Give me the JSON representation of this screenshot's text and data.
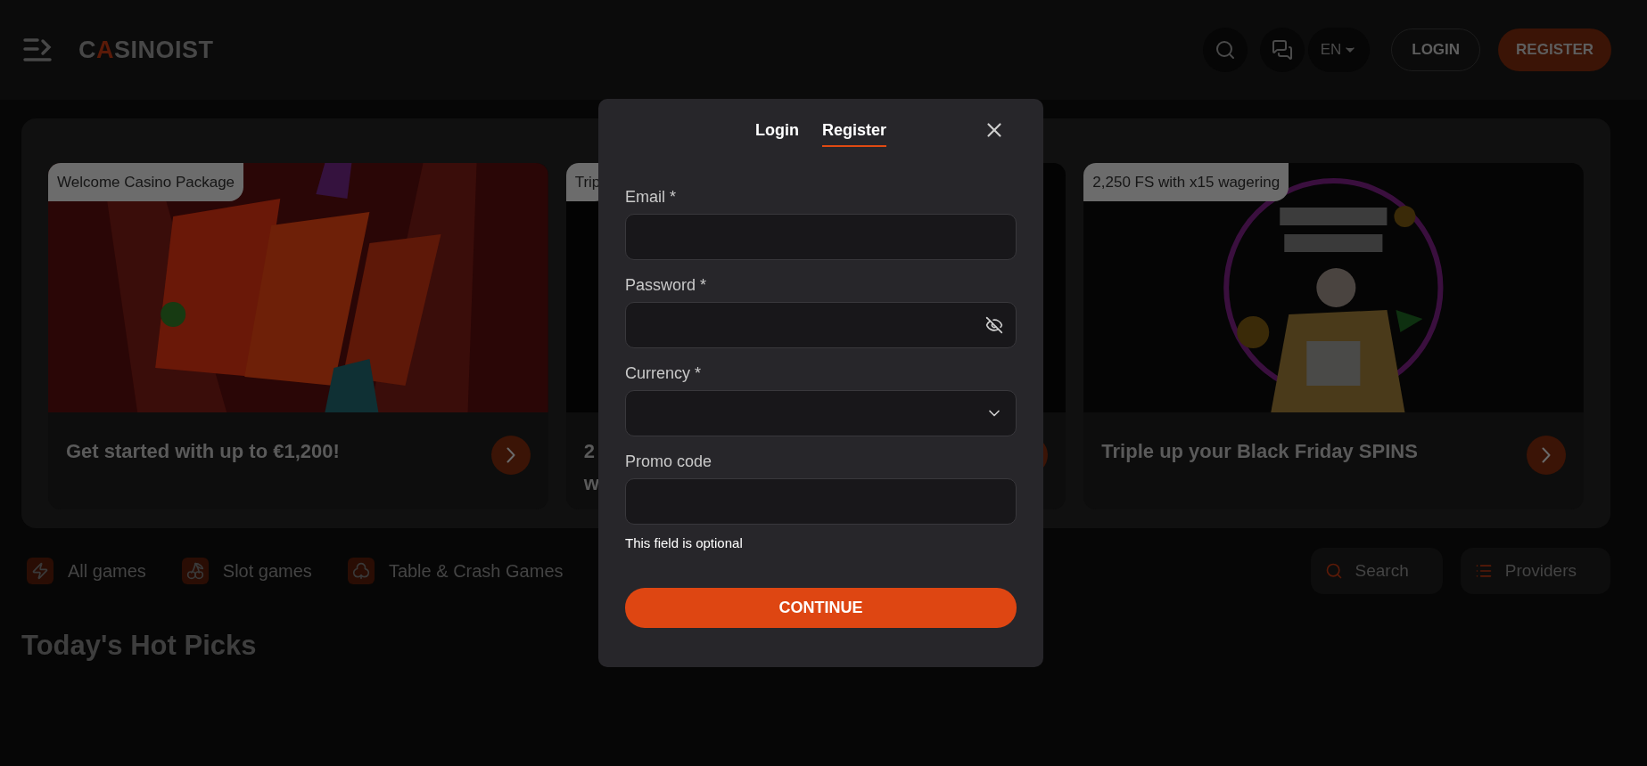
{
  "header": {
    "logo": "CASINOIST",
    "language": "EN",
    "buttons": [
      {
        "label": "LOGIN",
        "kind": "outline"
      },
      {
        "label": "REGISTER",
        "kind": "primary"
      }
    ]
  },
  "promos": [
    {
      "badge": "Welcome Casino Package",
      "title_lines": [
        "Get started with up to €1,200!"
      ]
    },
    {
      "badge": "Trip",
      "title_lines": [
        "2",
        "w"
      ]
    },
    {
      "badge": "2,250 FS with x15 wagering",
      "title_lines": [
        "Triple up your Black Friday SPINS"
      ]
    }
  ],
  "categories": [
    {
      "label": "All games"
    },
    {
      "label": "Slot games"
    },
    {
      "label": "Table & Crash Games"
    }
  ],
  "tools": [
    {
      "label": "Search",
      "kind": "search"
    },
    {
      "label": "Providers",
      "kind": "providers"
    }
  ],
  "section_title": "Today's Hot Picks",
  "modal": {
    "tabs": [
      {
        "label": "Login",
        "selected": false
      },
      {
        "label": "Register",
        "selected": true
      }
    ],
    "fields": [
      {
        "label": "Email *",
        "kind": "text"
      },
      {
        "label": "Password *",
        "kind": "password"
      },
      {
        "label": "Currency *",
        "kind": "select"
      },
      {
        "label": "Promo code",
        "kind": "text",
        "hint": "This field is optional"
      }
    ],
    "submit": "CONTINUE"
  }
}
